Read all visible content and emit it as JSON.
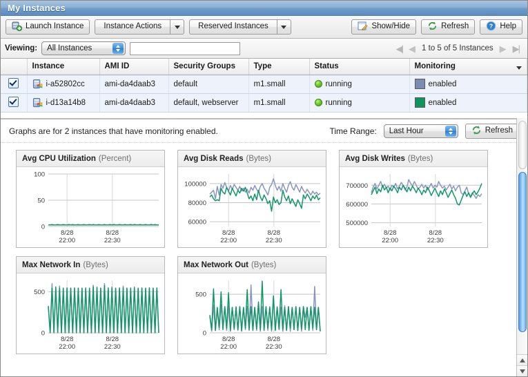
{
  "window": {
    "title": "My Instances"
  },
  "toolbar": {
    "launch_instance": "Launch Instance",
    "instance_actions": "Instance Actions",
    "reserved_instances": "Reserved Instances",
    "show_hide": "Show/Hide",
    "refresh": "Refresh",
    "help": "Help"
  },
  "viewbar": {
    "label": "Viewing:",
    "filter_value": "All Instances",
    "search_value": "",
    "search_placeholder": "",
    "pagination": "1 to 5 of 5 Instances"
  },
  "table": {
    "columns": [
      "",
      "Instance",
      "AMI ID",
      "Security Groups",
      "Type",
      "Status",
      "Monitoring"
    ],
    "rows": [
      {
        "checked": "true",
        "instance": "i-a52802cc",
        "ami_id": "ami-da4daab3",
        "security_groups": "default",
        "type": "m1.small",
        "status": "running",
        "monitoring": "enabled",
        "monitoring_color": "#7b8cb0"
      },
      {
        "checked": "true",
        "instance": "i-d13a14b8",
        "ami_id": "ami-da4daab3",
        "security_groups": "default, webserver",
        "type": "m1.small",
        "status": "running",
        "monitoring": "enabled",
        "monitoring_color": "#0f9460"
      }
    ]
  },
  "graphs_bar": {
    "note": "Graphs are for 2 instances that have monitoring enabled.",
    "time_range_label": "Time Range:",
    "time_range_value": "Last Hour",
    "refresh": "Refresh"
  },
  "colors": {
    "series_blue": "#8896bf",
    "series_green": "#119766",
    "accent": "#5d8cbf"
  },
  "chart_data": [
    {
      "type": "line",
      "title": "Avg CPU Utilization",
      "unit": "(Percent)",
      "ylabel": "Percent",
      "xlabel": "",
      "ylim": [
        0,
        100
      ],
      "yticks": [
        0,
        50,
        100
      ],
      "ytick_labels": [
        "0",
        "50",
        "100"
      ],
      "xticks": [
        0.17,
        0.58
      ],
      "xtick_labels": [
        "8/28 22:00",
        "8/28 22:30"
      ],
      "grid": true,
      "legend": "none",
      "series": [
        {
          "name": "i-a52802cc",
          "color": "#8896bf",
          "values": [
            3,
            3,
            4,
            3,
            3,
            4,
            3,
            3,
            4,
            3,
            3,
            4,
            3,
            4,
            3,
            3,
            4,
            3,
            3,
            4,
            3,
            3,
            4,
            3,
            4,
            3,
            3,
            4,
            3,
            3,
            4,
            3,
            3,
            4,
            3,
            4,
            3,
            3,
            4,
            3,
            3,
            4,
            3,
            3,
            4,
            3,
            4,
            3,
            3,
            4,
            3,
            3,
            4,
            3,
            3,
            4,
            3,
            4,
            3,
            3
          ]
        },
        {
          "name": "i-d13a14b8",
          "color": "#119766",
          "values": [
            3,
            3,
            3,
            3,
            3,
            3,
            3,
            3,
            3,
            3,
            3,
            3,
            3,
            3,
            3,
            3,
            3,
            3,
            3,
            3,
            3,
            3,
            3,
            3,
            3,
            3,
            3,
            3,
            3,
            3,
            3,
            3,
            3,
            3,
            3,
            3,
            3,
            3,
            3,
            3,
            3,
            3,
            3,
            3,
            3,
            3,
            3,
            3,
            3,
            3,
            3,
            3,
            3,
            3,
            3,
            3,
            3,
            3,
            3,
            3
          ]
        }
      ]
    },
    {
      "type": "line",
      "title": "Avg Disk Reads",
      "unit": "(Bytes)",
      "ylabel": "Bytes",
      "xlabel": "",
      "ylim": [
        55000,
        110000
      ],
      "yticks": [
        60000,
        80000,
        100000
      ],
      "ytick_labels": [
        "60000",
        "80000",
        "100000"
      ],
      "xticks": [
        0.17,
        0.58
      ],
      "xtick_labels": [
        "8/28 22:00",
        "8/28 22:30"
      ],
      "grid": true,
      "legend": "none",
      "series": [
        {
          "name": "i-a52802cc",
          "color": "#8896bf",
          "values": [
            89000,
            91000,
            93000,
            84000,
            97000,
            88000,
            99000,
            95000,
            101000,
            96000,
            92000,
            98000,
            94000,
            99000,
            96000,
            93000,
            97000,
            92000,
            95000,
            91000,
            94000,
            90000,
            96000,
            93000,
            98000,
            94000,
            91000,
            97000,
            100000,
            95000,
            92000,
            88000,
            96000,
            99000,
            105000,
            98000,
            93000,
            97000,
            92000,
            100000,
            95000,
            91000,
            98000,
            102000,
            96000,
            93000,
            99000,
            95000,
            91000,
            97000,
            93000,
            90000,
            94000,
            91000,
            88000,
            92000,
            89000,
            91000,
            88000,
            90000
          ]
        },
        {
          "name": "i-d13a14b8",
          "color": "#119766",
          "values": [
            86000,
            88000,
            84000,
            82000,
            83000,
            82000,
            95000,
            91000,
            89000,
            96000,
            92000,
            88000,
            95000,
            91000,
            87000,
            93000,
            90000,
            95000,
            92000,
            96000,
            90000,
            84000,
            87000,
            82000,
            89000,
            83000,
            93000,
            86000,
            82000,
            88000,
            84000,
            79000,
            82000,
            71000,
            86000,
            80000,
            83000,
            78000,
            80000,
            93000,
            86000,
            82000,
            87000,
            79000,
            84000,
            80000,
            76000,
            83000,
            79000,
            74000,
            88000,
            84000,
            89000,
            86000,
            82000,
            87000,
            84000,
            88000,
            83000,
            85000
          ]
        }
      ]
    },
    {
      "type": "line",
      "title": "Avg Disk Writes",
      "unit": "(Bytes)",
      "ylabel": "Bytes",
      "xlabel": "",
      "ylim": [
        480000,
        760000
      ],
      "yticks": [
        500000,
        600000,
        700000
      ],
      "ytick_labels": [
        "500000",
        "600000",
        "700000"
      ],
      "xticks": [
        0.17,
        0.58
      ],
      "xtick_labels": [
        "8/28 22:00",
        "8/28 22:30"
      ],
      "grid": true,
      "legend": "none",
      "series": [
        {
          "name": "i-a52802cc",
          "color": "#8896bf",
          "values": [
            660000,
            690000,
            710000,
            680000,
            700000,
            720000,
            690000,
            705000,
            685000,
            695000,
            675000,
            700000,
            690000,
            710000,
            680000,
            695000,
            715000,
            700000,
            675000,
            690000,
            730000,
            710000,
            695000,
            720000,
            700000,
            680000,
            690000,
            705000,
            685000,
            700000,
            675000,
            690000,
            710000,
            685000,
            700000,
            690000,
            720000,
            700000,
            685000,
            695000,
            675000,
            690000,
            705000,
            680000,
            695000,
            670000,
            690000,
            700000,
            660000,
            650000,
            670000,
            690000,
            655000,
            640000,
            660000,
            645000,
            630000,
            650000,
            640000,
            655000
          ]
        },
        {
          "name": "i-d13a14b8",
          "color": "#119766",
          "values": [
            650000,
            670000,
            690000,
            655000,
            680000,
            665000,
            700000,
            675000,
            690000,
            660000,
            685000,
            670000,
            695000,
            680000,
            660000,
            690000,
            675000,
            700000,
            685000,
            665000,
            690000,
            670000,
            695000,
            680000,
            660000,
            685000,
            670000,
            650000,
            675000,
            660000,
            690000,
            670000,
            645000,
            665000,
            685000,
            660000,
            640000,
            670000,
            650000,
            680000,
            660000,
            635000,
            655000,
            675000,
            650000,
            630000,
            600000,
            595000,
            620000,
            645000,
            665000,
            640000,
            660000,
            635000,
            655000,
            670000,
            650000,
            665000,
            685000,
            710000
          ]
        }
      ]
    },
    {
      "type": "line",
      "title": "Max Network In",
      "unit": "(Bytes)",
      "ylabel": "Bytes",
      "xlabel": "",
      "ylim": [
        0,
        640
      ],
      "yticks": [
        0,
        500
      ],
      "ytick_labels": [
        "0",
        "500"
      ],
      "xticks": [
        0.17,
        0.58
      ],
      "xtick_labels": [
        "8/28 22:00",
        "8/28 22:30"
      ],
      "grid": true,
      "legend": "none",
      "series": [
        {
          "name": "i-a52802cc",
          "color": "#8896bf",
          "values": [
            330,
            0,
            600,
            0,
            540,
            30,
            570,
            0,
            545,
            0,
            550,
            0,
            545,
            0,
            548,
            0,
            546,
            0,
            545,
            0,
            548,
            0,
            545,
            0,
            580,
            0,
            560,
            0,
            545,
            0,
            600,
            0,
            548,
            0,
            560,
            0,
            545,
            0,
            548,
            0,
            570,
            0,
            545,
            0,
            548,
            0,
            560,
            0,
            545,
            0,
            548,
            0,
            545,
            0,
            548,
            0,
            545,
            0,
            548,
            0
          ]
        },
        {
          "name": "i-d13a14b8",
          "color": "#119766",
          "values": [
            320,
            0,
            545,
            0,
            560,
            0,
            545,
            0,
            545,
            0,
            545,
            0,
            545,
            0,
            545,
            0,
            545,
            0,
            545,
            0,
            545,
            0,
            545,
            0,
            560,
            0,
            548,
            0,
            545,
            0,
            575,
            0,
            545,
            0,
            548,
            0,
            545,
            0,
            545,
            0,
            548,
            0,
            545,
            0,
            545,
            0,
            548,
            0,
            545,
            0,
            545,
            0,
            545,
            0,
            548,
            0,
            545,
            0,
            545,
            0
          ]
        }
      ]
    },
    {
      "type": "line",
      "title": "Max Network Out",
      "unit": "(Bytes)",
      "ylabel": "Bytes",
      "xlabel": "",
      "ylim": [
        0,
        680
      ],
      "yticks": [
        0,
        500
      ],
      "ytick_labels": [
        "0",
        "500"
      ],
      "xticks": [
        0.17,
        0.58
      ],
      "xtick_labels": [
        "8/28 22:00",
        "8/28 22:30"
      ],
      "grid": true,
      "legend": "none",
      "series": [
        {
          "name": "i-a52802cc",
          "color": "#8896bf",
          "values": [
            210,
            20,
            360,
            30,
            300,
            40,
            360,
            60,
            330,
            30,
            350,
            20,
            330,
            40,
            340,
            30,
            340,
            20,
            330,
            40,
            340,
            30,
            620,
            40,
            330,
            30,
            350,
            20,
            340,
            40,
            330,
            30,
            340,
            20,
            460,
            30,
            340,
            40,
            330,
            20,
            350,
            30,
            340,
            20,
            330,
            40,
            340,
            30,
            330,
            20,
            340,
            200,
            330,
            40,
            330,
            30,
            600,
            40,
            330,
            20
          ]
        },
        {
          "name": "i-d13a14b8",
          "color": "#119766",
          "values": [
            230,
            40,
            570,
            30,
            330,
            70,
            530,
            40,
            340,
            60,
            520,
            30,
            330,
            50,
            330,
            40,
            340,
            30,
            330,
            60,
            560,
            40,
            340,
            30,
            330,
            50,
            400,
            40,
            670,
            30,
            340,
            60,
            330,
            40,
            480,
            30,
            330,
            50,
            560,
            40,
            330,
            30,
            340,
            60,
            330,
            40,
            340,
            30,
            330,
            50,
            340,
            40,
            330,
            30,
            340,
            60,
            330,
            40,
            330,
            20
          ]
        }
      ]
    }
  ]
}
